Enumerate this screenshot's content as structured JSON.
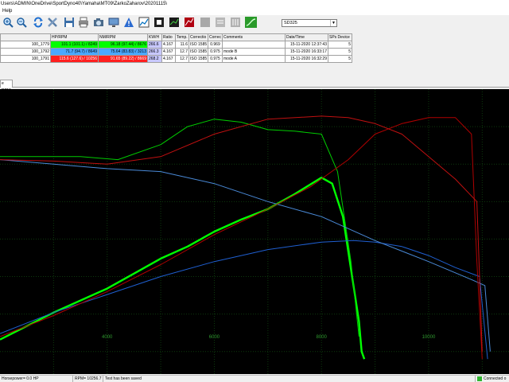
{
  "window": {
    "title": "Users\\ADMIN\\OneDrive\\SportDyno40\\Yamaha\\MT09\\ZarkoZaharov\\20201115\\"
  },
  "menu": {
    "items": [
      "Help"
    ]
  },
  "toolbar": {
    "buttons": [
      "zoom-in-icon",
      "zoom-out-icon",
      "refresh-icon",
      "tools-icon",
      "save-icon",
      "print-icon",
      "camera-icon",
      "monitor-icon",
      "warning-icon",
      "graph-icon",
      "stop-icon",
      "blank-icon",
      "sheet-icon",
      "settings-icon",
      "curve-icon"
    ],
    "combo_value": "SD325"
  },
  "runs_table": {
    "columns": [
      "",
      "HP/RPM",
      "NM/RPM",
      "KW/H",
      "Ratio",
      "Temp.",
      "Correctio",
      "Correc",
      "Comments",
      "Date/Time",
      "SPs Device"
    ],
    "rows": [
      {
        "id": "100_1779",
        "hp": "101.1 (101.1) / 8249",
        "nm": "96.18 (97.44) / 8676",
        "kwh": "266.6",
        "ratio": "4.167",
        "temp": "11.6",
        "corr": "ISO 1585",
        "factor": "0.969",
        "comment": "",
        "date": "15-11-2020 12:37:43",
        "sp": "5",
        "color": "#00ff00"
      },
      {
        "id": "100_1792",
        "hp": "71.7 (94.7) / 8649",
        "nm": "75.64 (83.83) / 3213",
        "kwh": "266.3",
        "ratio": "4.167",
        "temp": "12.7",
        "corr": "ISO 1585",
        "factor": "0.975",
        "comment": "mode B",
        "date": "15-11-2020 16:33:17",
        "sp": "5",
        "color": "#4aa8ff"
      },
      {
        "id": "100_1791",
        "hp": "115.6 (127.6) / 10256",
        "nm": "91.65 (89.22) / 8669",
        "kwh": "268.2",
        "ratio": "4.167",
        "temp": "12.7",
        "corr": "ISO 1585",
        "factor": "0.975",
        "comment": "mode A",
        "date": "15-11-2020 16:32:29",
        "sp": "5",
        "color": "#ff1f1f"
      }
    ]
  },
  "tabs": [
    {
      "label": "e RPM"
    }
  ],
  "chart_data": {
    "type": "line",
    "xlabel": "",
    "ylabel": "",
    "x_ticks": [
      "4000",
      "6000",
      "8000",
      "10000"
    ],
    "grid": true,
    "series": [
      {
        "color": "#00ff00",
        "metric": "power",
        "x": [
          2000,
          3000,
          4000,
          4500,
          5000,
          5500,
          6000,
          6500,
          7000,
          7500,
          8000,
          8200,
          8400,
          8550,
          8700,
          8750,
          8800
        ],
        "y": [
          0.08,
          0.26,
          0.42,
          0.52,
          0.62,
          0.7,
          0.8,
          0.88,
          0.95,
          1.05,
          1.16,
          1.12,
          0.9,
          0.55,
          0.2,
          0.0,
          -0.05
        ]
      },
      {
        "color": "#00cc00",
        "metric": "torque",
        "x": [
          2000,
          2600,
          3500,
          4200,
          5000,
          5500,
          6000,
          6500,
          7000,
          7500,
          8000,
          8300,
          8550,
          8700
        ],
        "y": [
          1.3,
          1.3,
          1.3,
          1.28,
          1.38,
          1.5,
          1.55,
          1.53,
          1.48,
          1.47,
          1.45,
          1.2,
          0.6,
          0.1
        ]
      },
      {
        "color": "#1f5fd0",
        "metric": "power",
        "x": [
          2000,
          3000,
          4000,
          5000,
          6000,
          7000,
          8000,
          8600,
          9000,
          9500,
          10000,
          10500,
          10950,
          11100
        ],
        "y": [
          0.12,
          0.26,
          0.38,
          0.5,
          0.6,
          0.68,
          0.73,
          0.74,
          0.73,
          0.7,
          0.64,
          0.56,
          0.5,
          -0.05
        ]
      },
      {
        "color": "#4a8ad8",
        "metric": "torque",
        "x": [
          2000,
          3000,
          4000,
          5000,
          6000,
          7000,
          8000,
          9000,
          10000,
          10800,
          11050,
          11150
        ],
        "y": [
          1.28,
          1.25,
          1.22,
          1.2,
          1.12,
          1.0,
          0.9,
          0.74,
          0.6,
          0.48,
          0.44,
          0.0
        ]
      },
      {
        "color": "#b00000",
        "metric": "power",
        "x": [
          2000,
          3000,
          4000,
          5000,
          6000,
          7000,
          7800,
          8500,
          9000,
          9500,
          10000,
          10500,
          10800,
          10900,
          11000
        ],
        "y": [
          0.1,
          0.24,
          0.4,
          0.58,
          0.78,
          0.95,
          1.1,
          1.28,
          1.45,
          1.52,
          1.56,
          1.56,
          1.45,
          0.6,
          -0.05
        ]
      },
      {
        "color": "#c01010",
        "metric": "torque",
        "x": [
          2000,
          3000,
          4000,
          5000,
          6000,
          7000,
          8000,
          8500,
          9000,
          9500,
          10000,
          10500,
          10900,
          11000
        ],
        "y": [
          1.28,
          1.27,
          1.25,
          1.3,
          1.45,
          1.55,
          1.57,
          1.56,
          1.52,
          1.45,
          1.3,
          1.15,
          1.0,
          0.0
        ]
      }
    ]
  },
  "status": {
    "hp": "Horsepower= 0.0 HP",
    "rpm": "RPM= 10256.7",
    "msg": "Test has been saved",
    "conn": "Connected o"
  }
}
